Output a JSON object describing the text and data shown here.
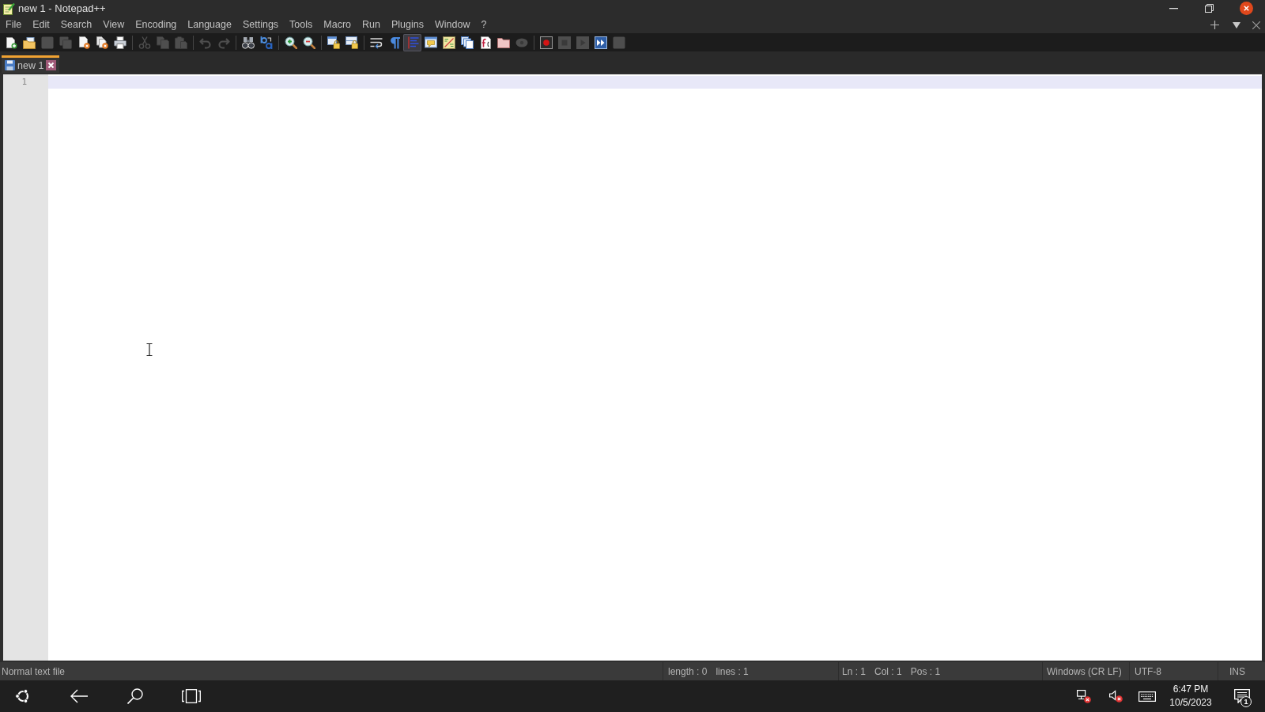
{
  "window": {
    "title": "new 1 - Notepad++"
  },
  "menu": [
    "File",
    "Edit",
    "Search",
    "View",
    "Encoding",
    "Language",
    "Settings",
    "Tools",
    "Macro",
    "Run",
    "Plugins",
    "Window",
    "?"
  ],
  "toolbar": [
    [
      {
        "kind": "new",
        "disabled": false,
        "on": false
      },
      {
        "kind": "open",
        "disabled": false,
        "on": false
      },
      {
        "kind": "save",
        "disabled": true,
        "on": false
      },
      {
        "kind": "saveall",
        "disabled": true,
        "on": false
      },
      {
        "kind": "close",
        "disabled": false,
        "on": false
      },
      {
        "kind": "closeall",
        "disabled": false,
        "on": false
      },
      {
        "kind": "print",
        "disabled": false,
        "on": false
      }
    ],
    [
      {
        "kind": "cut",
        "disabled": true,
        "on": false
      },
      {
        "kind": "copy",
        "disabled": true,
        "on": false
      },
      {
        "kind": "paste",
        "disabled": true,
        "on": false
      }
    ],
    [
      {
        "kind": "undo",
        "disabled": true,
        "on": false
      },
      {
        "kind": "redo",
        "disabled": true,
        "on": false
      }
    ],
    [
      {
        "kind": "find",
        "disabled": false,
        "on": false
      },
      {
        "kind": "replace",
        "disabled": false,
        "on": false
      }
    ],
    [
      {
        "kind": "zoomin",
        "disabled": false,
        "on": false
      },
      {
        "kind": "zoomout",
        "disabled": false,
        "on": false
      }
    ],
    [
      {
        "kind": "syncv",
        "disabled": false,
        "on": false
      },
      {
        "kind": "synch",
        "disabled": false,
        "on": false
      }
    ],
    [
      {
        "kind": "wrap",
        "disabled": false,
        "on": false
      },
      {
        "kind": "allchars",
        "disabled": false,
        "on": false
      },
      {
        "kind": "indent",
        "disabled": false,
        "on": true
      },
      {
        "kind": "udl",
        "disabled": false,
        "on": false
      },
      {
        "kind": "map",
        "disabled": false,
        "on": false
      },
      {
        "kind": "doclist",
        "disabled": false,
        "on": false
      },
      {
        "kind": "function",
        "disabled": false,
        "on": false
      },
      {
        "kind": "folder",
        "disabled": false,
        "on": false
      },
      {
        "kind": "monitor",
        "disabled": true,
        "on": false
      }
    ],
    [
      {
        "kind": "record",
        "disabled": false,
        "on": false
      },
      {
        "kind": "stop",
        "disabled": true,
        "on": false
      },
      {
        "kind": "play",
        "disabled": true,
        "on": false
      },
      {
        "kind": "playmany",
        "disabled": false,
        "on": false
      },
      {
        "kind": "savemacro",
        "disabled": true,
        "on": false
      }
    ]
  ],
  "tabs": [
    {
      "label": "new 1",
      "selected": true
    }
  ],
  "editor": {
    "lines": [
      {
        "number": "1",
        "current": true
      }
    ]
  },
  "status_bar": {
    "sections": [
      [
        "Normal text file"
      ],
      [
        "length : 0",
        "lines : 1"
      ],
      [
        "Ln : 1",
        "Col : 1",
        "Pos : 1"
      ],
      [
        "Windows (CR LF)"
      ],
      [
        "UTF-8"
      ],
      [
        "INS"
      ]
    ]
  },
  "taskbar": {
    "clock": {
      "time": "6:47 PM",
      "date": "10/5/2023"
    },
    "notifications": {
      "count": "1"
    }
  }
}
